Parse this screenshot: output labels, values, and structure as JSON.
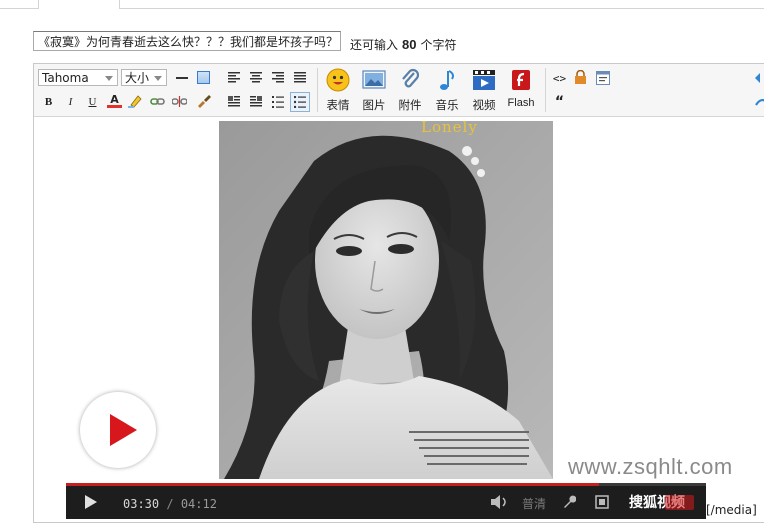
{
  "post": {
    "title_value": "《寂寞》为何青春逝去这么快？？？我们都是坏孩子吗？",
    "remain_prefix": "还可输入",
    "remain_count": "80",
    "remain_suffix": "个字符"
  },
  "toolbar": {
    "font_select": "Tahoma",
    "size_select": "大小",
    "buttons": [
      {
        "label": "表情",
        "icon": "smiley-icon"
      },
      {
        "label": "图片",
        "icon": "image-icon"
      },
      {
        "label": "附件",
        "icon": "paperclip-icon"
      },
      {
        "label": "音乐",
        "icon": "music-note-icon"
      },
      {
        "label": "视频",
        "icon": "video-icon"
      },
      {
        "label": "Flash",
        "icon": "flash-icon"
      }
    ],
    "format_glyphs": {
      "bold": "B",
      "italic": "I",
      "underline": "U",
      "color": "A"
    },
    "code_glyph": "<>",
    "quote_glyph": "“"
  },
  "content": {
    "photo_caption_text": "Lonely",
    "watermark": "www.zsqhlt.com",
    "media_tag": "[/media]"
  },
  "player": {
    "time_current": "03:30",
    "time_total": "04:12",
    "quality": "普清",
    "brand": "搜狐视频",
    "progress": 0.833
  },
  "colors": {
    "accent_red": "#d7171b",
    "player_bg": "#1d1d1d",
    "toolbar_bg": "#f6f6f6"
  }
}
